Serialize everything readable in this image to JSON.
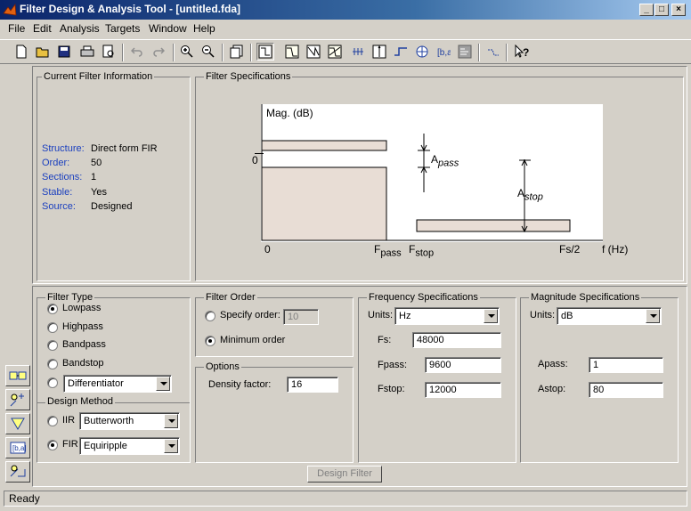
{
  "window": {
    "title": "Filter Design & Analysis Tool - [untitled.fda]"
  },
  "menu": [
    "File",
    "Edit",
    "Analysis",
    "Targets",
    "Window",
    "Help"
  ],
  "toolbar": {
    "icons": [
      "new-icon",
      "open-icon",
      "save-icon",
      "print-icon",
      "print-preview-icon",
      "undo-icon",
      "redo-icon",
      "zoom-in-icon",
      "zoom-out-icon",
      "full-view-icon",
      "filter-specs-icon",
      "magnitude-response-icon",
      "phase-response-icon",
      "mag-phase-icon",
      "group-delay-icon",
      "impulse-response-icon",
      "step-response-icon",
      "pole-zero-icon",
      "coefficients-icon",
      "filter-info-icon",
      "help-whats-this-icon"
    ]
  },
  "current_info": {
    "legend": "Current Filter Information",
    "rows": [
      {
        "label": "Structure:",
        "value": "Direct form FIR"
      },
      {
        "label": "Order:",
        "value": "50"
      },
      {
        "label": "Sections:",
        "value": "1"
      },
      {
        "label": "Stable:",
        "value": "Yes"
      },
      {
        "label": "Source:",
        "value": "Designed"
      }
    ]
  },
  "specs": {
    "legend": "Filter Specifications",
    "ylabel": "Mag. (dB)",
    "zero_y": "0",
    "zero_x": "0",
    "fpass": "F",
    "fpass_sub": "pass",
    "fstop": "F",
    "fstop_sub": "stop",
    "fs2": "Fs/2",
    "fhz": "f (Hz)",
    "apass": "A",
    "apass_sub": "pass",
    "astop": "A",
    "astop_sub": "stop"
  },
  "filter_type": {
    "legend": "Filter Type",
    "options": [
      "Lowpass",
      "Highpass",
      "Bandpass",
      "Bandstop"
    ],
    "selected": "Lowpass",
    "other_value": "Differentiator"
  },
  "design_method": {
    "legend": "Design Method",
    "iir_label": "IIR",
    "iir_value": "Butterworth",
    "fir_label": "FIR",
    "fir_value": "Equiripple"
  },
  "filter_order": {
    "legend": "Filter Order",
    "specify_label": "Specify order:",
    "specify_value": "10",
    "minimum_label": "Minimum order"
  },
  "options": {
    "legend": "Options",
    "density_label": "Density factor:",
    "density_value": "16"
  },
  "freq_specs": {
    "legend": "Frequency Specifications",
    "units_label": "Units:",
    "units_value": "Hz",
    "fs_label": "Fs:",
    "fs_value": "48000",
    "fpass_label": "Fpass:",
    "fpass_value": "9600",
    "fstop_label": "Fstop:",
    "fstop_value": "12000"
  },
  "mag_specs": {
    "legend": "Magnitude Specifications",
    "units_label": "Units:",
    "units_value": "dB",
    "apass_label": "Apass:",
    "apass_value": "1",
    "astop_label": "Astop:",
    "astop_value": "80"
  },
  "design_button": "Design Filter",
  "sidebar_icons": [
    "pole-zero-editor-icon",
    "import-filter-icon",
    "transform-filter-icon",
    "realize-model-icon",
    "multirate-icon"
  ],
  "status": "Ready"
}
